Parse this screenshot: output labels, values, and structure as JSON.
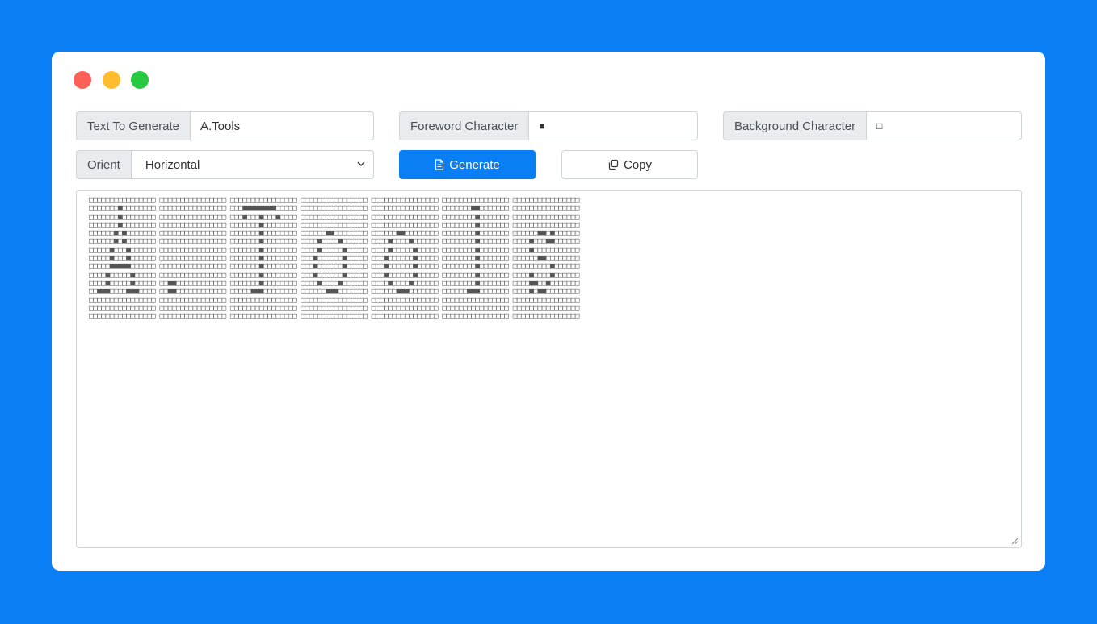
{
  "window": {
    "controls": [
      "close",
      "minimize",
      "maximize"
    ]
  },
  "form": {
    "text_label": "Text To Generate",
    "text_value": "A.Tools",
    "fore_label": "Foreword Character",
    "fore_value": "■",
    "back_label": "Background Character",
    "back_value": "□",
    "orient_label": "Orient",
    "orient_value": "Horizontal",
    "generate_label": "Generate",
    "copy_label": "Copy"
  },
  "output": {
    "lines": [
      "□□□□□□□□□□□□□□□□ □□□□□□□□□□□□□□□□ □□□□□□□□□□□□□□□□ □□□□□□□□□□□□□□□□ □□□□□□□□□□□□□□□□ □□□□□□□□□□□□□□□□ □□□□□□□□□□□□□□□□",
      "□□□□□□□■□□□□□□□□ □□□□□□□□□□□□□□□□ □□□■■■■■■■■□□□□□ □□□□□□□□□□□□□□□□ □□□□□□□□□□□□□□□□ □□□□□□□■■□□□□□□□ □□□□□□□□□□□□□□□□",
      "□□□□□□□■□□□□□□□□ □□□□□□□□□□□□□□□□ □□□■□□□■□□□■□□□□ □□□□□□□□□□□□□□□□ □□□□□□□□□□□□□□□□ □□□□□□□□■□□□□□□□ □□□□□□□□□□□□□□□□",
      "□□□□□□□■□□□□□□□□ □□□□□□□□□□□□□□□□ □□□□□□□■□□□□□□□□ □□□□□□□□□□□□□□□□ □□□□□□□□□□□□□□□□ □□□□□□□□■□□□□□□□ □□□□□□□□□□□□□□□□",
      "□□□□□□■□■□□□□□□□ □□□□□□□□□□□□□□□□ □□□□□□□■□□□□□□□□ □□□□□□■■□□□□□□□□ □□□□□□■■□□□□□□□□ □□□□□□□□■□□□□□□□ □□□□□□■■□■□□□□□□",
      "□□□□□□■□■□□□□□□□ □□□□□□□□□□□□□□□□ □□□□□□□■□□□□□□□□ □□□□■□□□□■□□□□□□ □□□□■□□□□■□□□□□□ □□□□□□□□■□□□□□□□ □□□□■□□□■■□□□□□□",
      "□□□□□■□□□■□□□□□□ □□□□□□□□□□□□□□□□ □□□□□□□■□□□□□□□□ □□□□■□□□□□■□□□□□ □□□□■□□□□□■□□□□□ □□□□□□□□■□□□□□□□ □□□□■□□□□□□□□□□□",
      "□□□□□■□□□■□□□□□□ □□□□□□□□□□□□□□□□ □□□□□□□■□□□□□□□□ □□□■□□□□□□■□□□□□ □□□■□□□□□□■□□□□□ □□□□□□□□■□□□□□□□ □□□□□□■■□□□□□□□□",
      "□□□□□■■■■■□□□□□□ □□□□□□□□□□□□□□□□ □□□□□□□■□□□□□□□□ □□□■□□□□□□■□□□□□ □□□■□□□□□□■□□□□□ □□□□□□□□■□□□□□□□ □□□□□□□□□■□□□□□□",
      "□□□□■□□□□□■□□□□□ □□□□□□□□□□□□□□□□ □□□□□□□■□□□□□□□□ □□□■□□□□□□■□□□□□ □□□■□□□□□□■□□□□□ □□□□□□□□■□□□□□□□ □□□□■□□□□■□□□□□□",
      "□□□□■□□□□□■□□□□□ □□■■□□□□□□□□□□□□ □□□□□□□■□□□□□□□□ □□□□■□□□□■□□□□□□ □□□□■□□□□■□□□□□□ □□□□□□□□■□□□□□□□ □□□□■■□□■□□□□□□□",
      "□□■■■□□□□■■■□□□□ □□■■□□□□□□□□□□□□ □□□□□■■■□□□□□□□□ □□□□□□■■■□□□□□□□ □□□□□□■■■□□□□□□□ □□□□□□■■■□□□□□□□ □□□□■□■■□□□□□□□□",
      "□□□□□□□□□□□□□□□□ □□□□□□□□□□□□□□□□ □□□□□□□□□□□□□□□□ □□□□□□□□□□□□□□□□ □□□□□□□□□□□□□□□□ □□□□□□□□□□□□□□□□ □□□□□□□□□□□□□□□□",
      "□□□□□□□□□□□□□□□□ □□□□□□□□□□□□□□□□ □□□□□□□□□□□□□□□□ □□□□□□□□□□□□□□□□ □□□□□□□□□□□□□□□□ □□□□□□□□□□□□□□□□ □□□□□□□□□□□□□□□□",
      "□□□□□□□□□□□□□□□□ □□□□□□□□□□□□□□□□ □□□□□□□□□□□□□□□□ □□□□□□□□□□□□□□□□ □□□□□□□□□□□□□□□□ □□□□□□□□□□□□□□□□ □□□□□□□□□□□□□□□□"
    ]
  }
}
